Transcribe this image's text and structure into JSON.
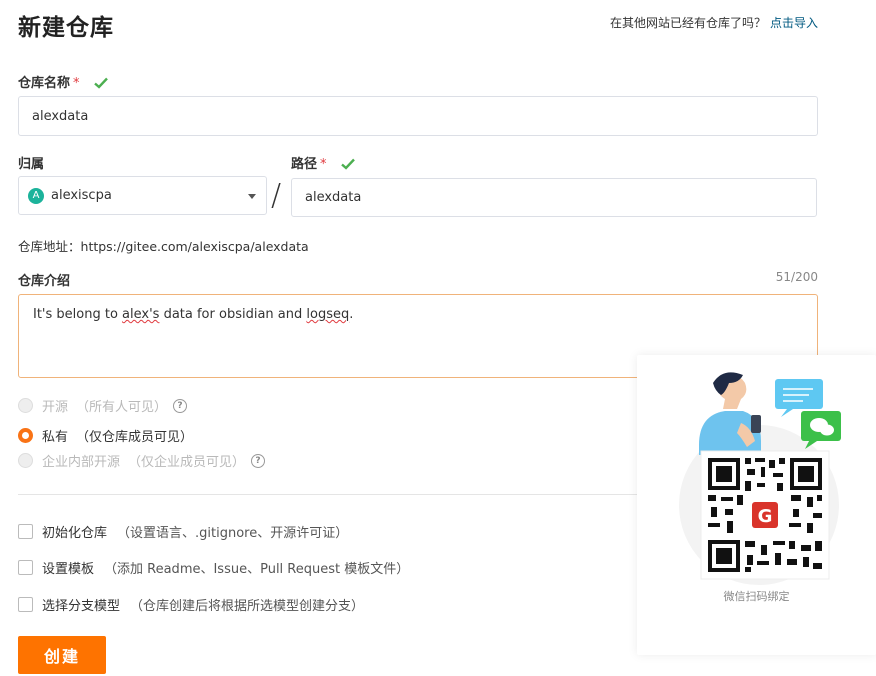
{
  "page": {
    "title": "新建仓库"
  },
  "import_hint": {
    "text": "在其他网站已经有仓库了吗？",
    "link": "点击导入"
  },
  "repo_name": {
    "label": "仓库名称",
    "required": "*",
    "value": "alexdata"
  },
  "owner": {
    "label": "归属",
    "avatar_letter": "A",
    "value": "alexiscpa"
  },
  "path": {
    "label": "路径",
    "required": "*",
    "separator": "/",
    "value": "alexdata"
  },
  "address": {
    "label": "仓库地址：",
    "value": "https://gitee.com/alexiscpa/alexdata"
  },
  "intro": {
    "label": "仓库介绍",
    "counter": "51/200",
    "text_before": "It's belong to ",
    "text_sq1": "alex's",
    "text_mid": " data for obsidian and ",
    "text_sq2": "logseq",
    "text_after": "."
  },
  "visibility": {
    "options": [
      {
        "label": "开源",
        "desc": "（所有人可见）",
        "selected": false,
        "disabled": true
      },
      {
        "label": "私有",
        "desc": "（仅仓库成员可见）",
        "selected": true,
        "disabled": false
      },
      {
        "label": "企业内部开源",
        "desc": "（仅企业成员可见）",
        "selected": false,
        "disabled": true
      }
    ],
    "help_glyph": "?"
  },
  "options": [
    {
      "label": "初始化仓库",
      "desc": "（设置语言、.gitignore、开源许可证）"
    },
    {
      "label": "设置模板",
      "desc": "（添加 Readme、Issue、Pull Request 模板文件）"
    },
    {
      "label": "选择分支模型",
      "desc": "（仓库创建后将根据所选模型创建分支）"
    }
  ],
  "create_button": {
    "label": "创建"
  },
  "qr_panel": {
    "caption": "微信扫码绑定",
    "logo_letter": "G"
  },
  "colors": {
    "accent": "#fe7300",
    "valid_check": "#4caf50",
    "link": "#005980",
    "required": "#e0393e"
  }
}
